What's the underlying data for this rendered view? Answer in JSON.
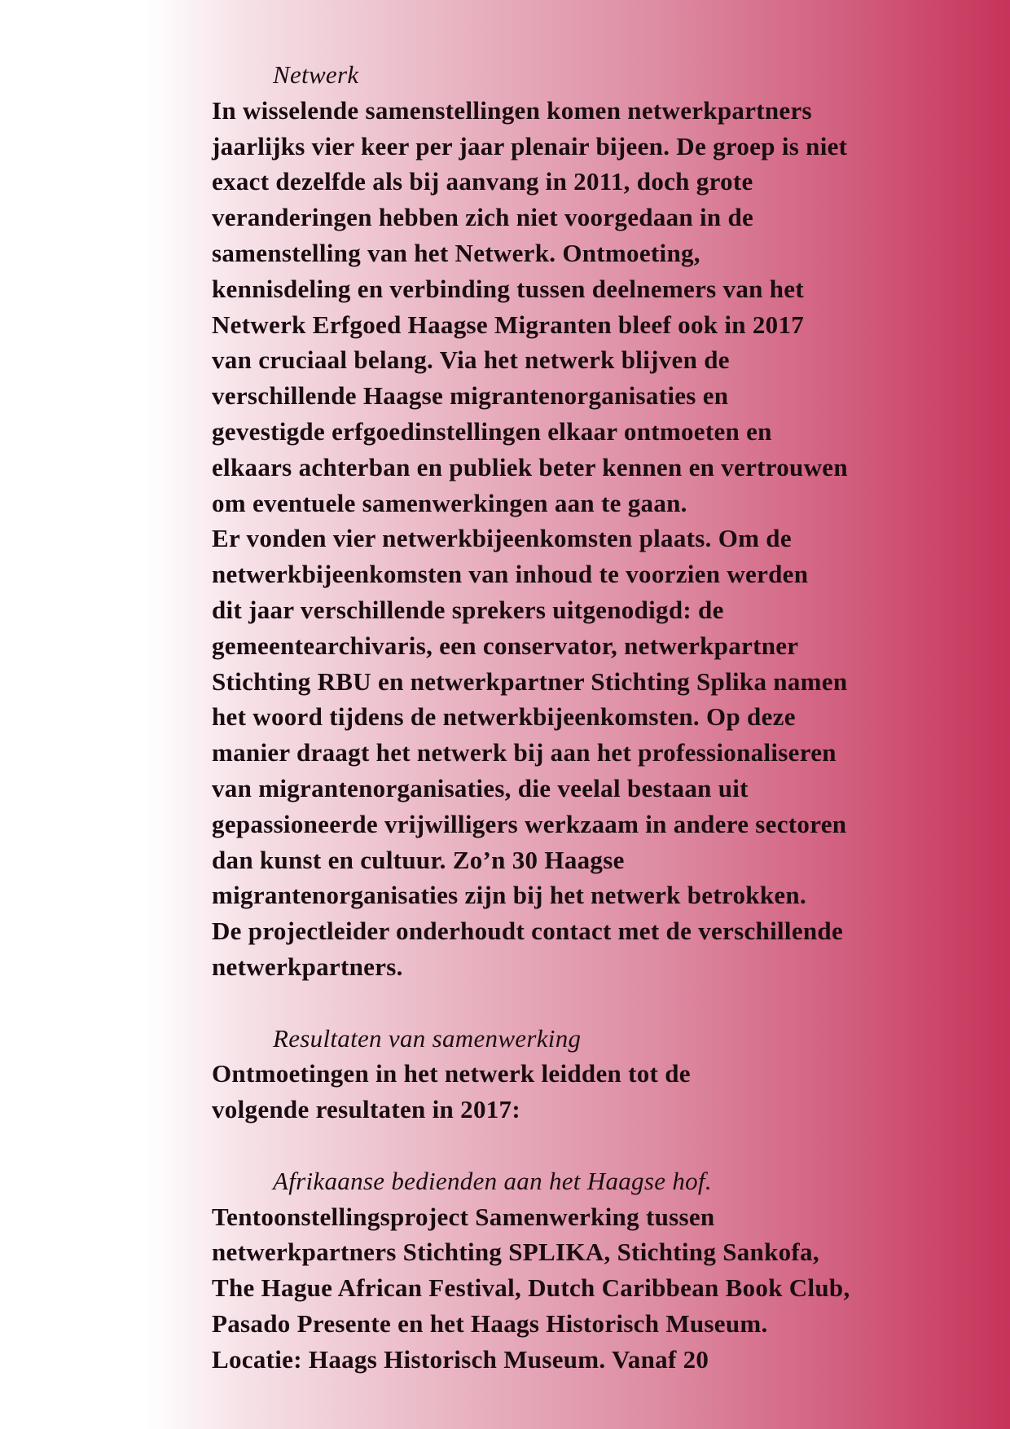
{
  "section_netwerk": {
    "heading": "Netwerk",
    "lines": [
      "In wisselende samenstellingen komen netwerkpartners",
      "jaarlijks vier keer per jaar plenair bijeen. De groep is niet",
      "exact dezelfde als bij aanvang in 2011, doch grote",
      "veranderingen hebben zich niet voorgedaan in de",
      "samenstelling van het Netwerk. Ontmoeting,",
      "kennisdeling en verbinding tussen deelnemers van het",
      "Netwerk Erfgoed Haagse Migranten bleef ook in 2017",
      "van cruciaal belang. Via het netwerk blijven de",
      "verschillende Haagse migrantenorganisaties en",
      "gevestigde erfgoedinstellingen elkaar ontmoeten en",
      "elkaars achterban en publiek beter kennen en vertrouwen",
      "om eventuele samenwerkingen aan te gaan.",
      "Er vonden vier netwerkbijeenkomsten plaats. Om de",
      "netwerkbijeenkomsten van inhoud te voorzien werden",
      "dit jaar verschillende sprekers uitgenodigd: de",
      "gemeentearchivaris, een conservator, netwerkpartner",
      "Stichting RBU en netwerkpartner Stichting Splika namen",
      "het woord tijdens de netwerkbijeenkomsten. Op deze",
      "manier draagt het netwerk bij aan het professionaliseren",
      "van migrantenorganisaties, die veelal bestaan uit",
      "gepassioneerde vrijwilligers werkzaam in andere sectoren",
      "dan kunst en cultuur. Zo’n 30 Haagse",
      "migrantenorganisaties zijn bij het netwerk betrokken.",
      "De projectleider onderhoudt contact met de verschillende",
      "netwerkpartners."
    ]
  },
  "section_resultaten": {
    "heading": "Resultaten van samenwerking",
    "lines": [
      "Ontmoetingen in het netwerk leidden tot de",
      "volgende resultaten in 2017:"
    ]
  },
  "section_afrikaanse": {
    "heading": "Afrikaanse bedienden aan het Haagse hof.",
    "lines": [
      "Tentoonstellingsproject Samenwerking tussen",
      "netwerkpartners Stichting SPLIKA, Stichting Sankofa,",
      "The Hague African Festival, Dutch Caribbean Book Club,",
      "Pasado Presente en het Haags Historisch Museum.",
      "Locatie: Haags Historisch Museum. Vanaf 20"
    ]
  },
  "colors": {
    "gradient_start": "#ffffff",
    "gradient_end": "#c7335a",
    "text": "#1a0d12"
  }
}
